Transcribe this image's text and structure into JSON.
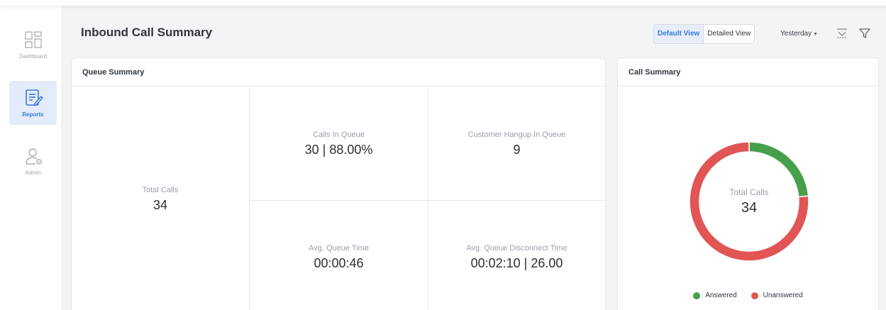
{
  "sidebar": {
    "items": [
      {
        "label": "Dashboard",
        "icon": "dashboard-icon",
        "active": false
      },
      {
        "label": "Reports",
        "icon": "reports-icon",
        "active": true
      },
      {
        "label": "Admin",
        "icon": "admin-icon",
        "active": false
      }
    ]
  },
  "header": {
    "title": "Inbound Call Summary",
    "views": [
      "Default View",
      "Detailed View"
    ],
    "active_view": "Default View",
    "date_range": "Yesterday",
    "export_icon": "export-icon",
    "filter_icon": "filter-icon"
  },
  "queue_summary": {
    "title": "Queue Summary",
    "total_calls": {
      "label": "Total Calls",
      "value": "34"
    },
    "calls_in_queue": {
      "label": "Calls In Queue",
      "value": "30 | 88.00%"
    },
    "customer_hangup": {
      "label": "Customer Hangup In Queue",
      "value": "9"
    },
    "avg_queue_time": {
      "label": "Avg. Queue Time",
      "value": "00:00:46"
    },
    "avg_disconnect": {
      "label": "Avg. Queue Disconnect Time",
      "value": "00:02:10 | 26.00"
    }
  },
  "call_summary": {
    "title": "Call Summary",
    "center_label": "Total Calls",
    "center_value": "34",
    "legend": [
      {
        "label": "Answered",
        "color": "#45a049"
      },
      {
        "label": "Unanswered",
        "color": "#e25555"
      }
    ]
  },
  "chart_data": {
    "type": "pie",
    "categories": [
      "Answered",
      "Unanswered"
    ],
    "values": [
      8,
      26
    ],
    "title": "Call Summary"
  }
}
